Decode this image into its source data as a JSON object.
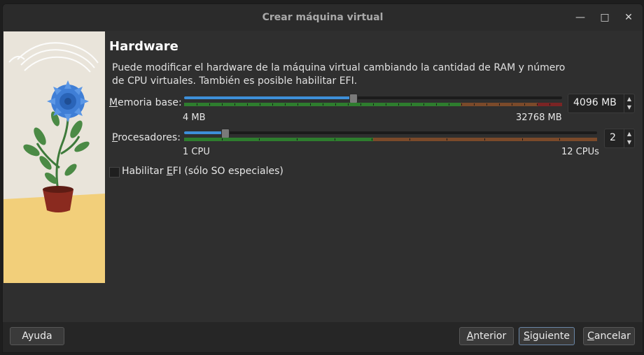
{
  "window": {
    "title": "Crear máquina virtual"
  },
  "page": {
    "heading": "Hardware",
    "description": "Puede modificar el hardware de la máquina virtual cambiando la cantidad de RAM y número de CPU virtuales. También es posible habilitar EFI."
  },
  "memory": {
    "label_mnemonic": "M",
    "label_rest": "emoria base:",
    "value_text": "4096 MB",
    "min_label": "4 MB",
    "max_label": "32768 MB",
    "value": 4096,
    "min": 4,
    "max": 32768
  },
  "cpu": {
    "label_mnemonic": "P",
    "label_rest": "rocesadores:",
    "value_text": "2",
    "min_label": "1 CPU",
    "max_label": "12 CPUs",
    "value": 2,
    "min": 1,
    "max": 12
  },
  "efi": {
    "label_pre": "Habilitar ",
    "label_mnemonic": "E",
    "label_post": "FI (sólo SO especiales)",
    "checked": false
  },
  "buttons": {
    "help": "Ayuda",
    "back_mnemonic": "A",
    "back_rest": "nterior",
    "next_mnemonic": "S",
    "next_rest": "iguiente",
    "cancel_mnemonic": "C",
    "cancel_rest": "ancelar"
  },
  "colors": {
    "slider_fill": "#3d8fd9",
    "bar_ok": "#2e7d2e",
    "bar_warn": "#7b4a2a",
    "bar_bad": "#7a2424"
  }
}
